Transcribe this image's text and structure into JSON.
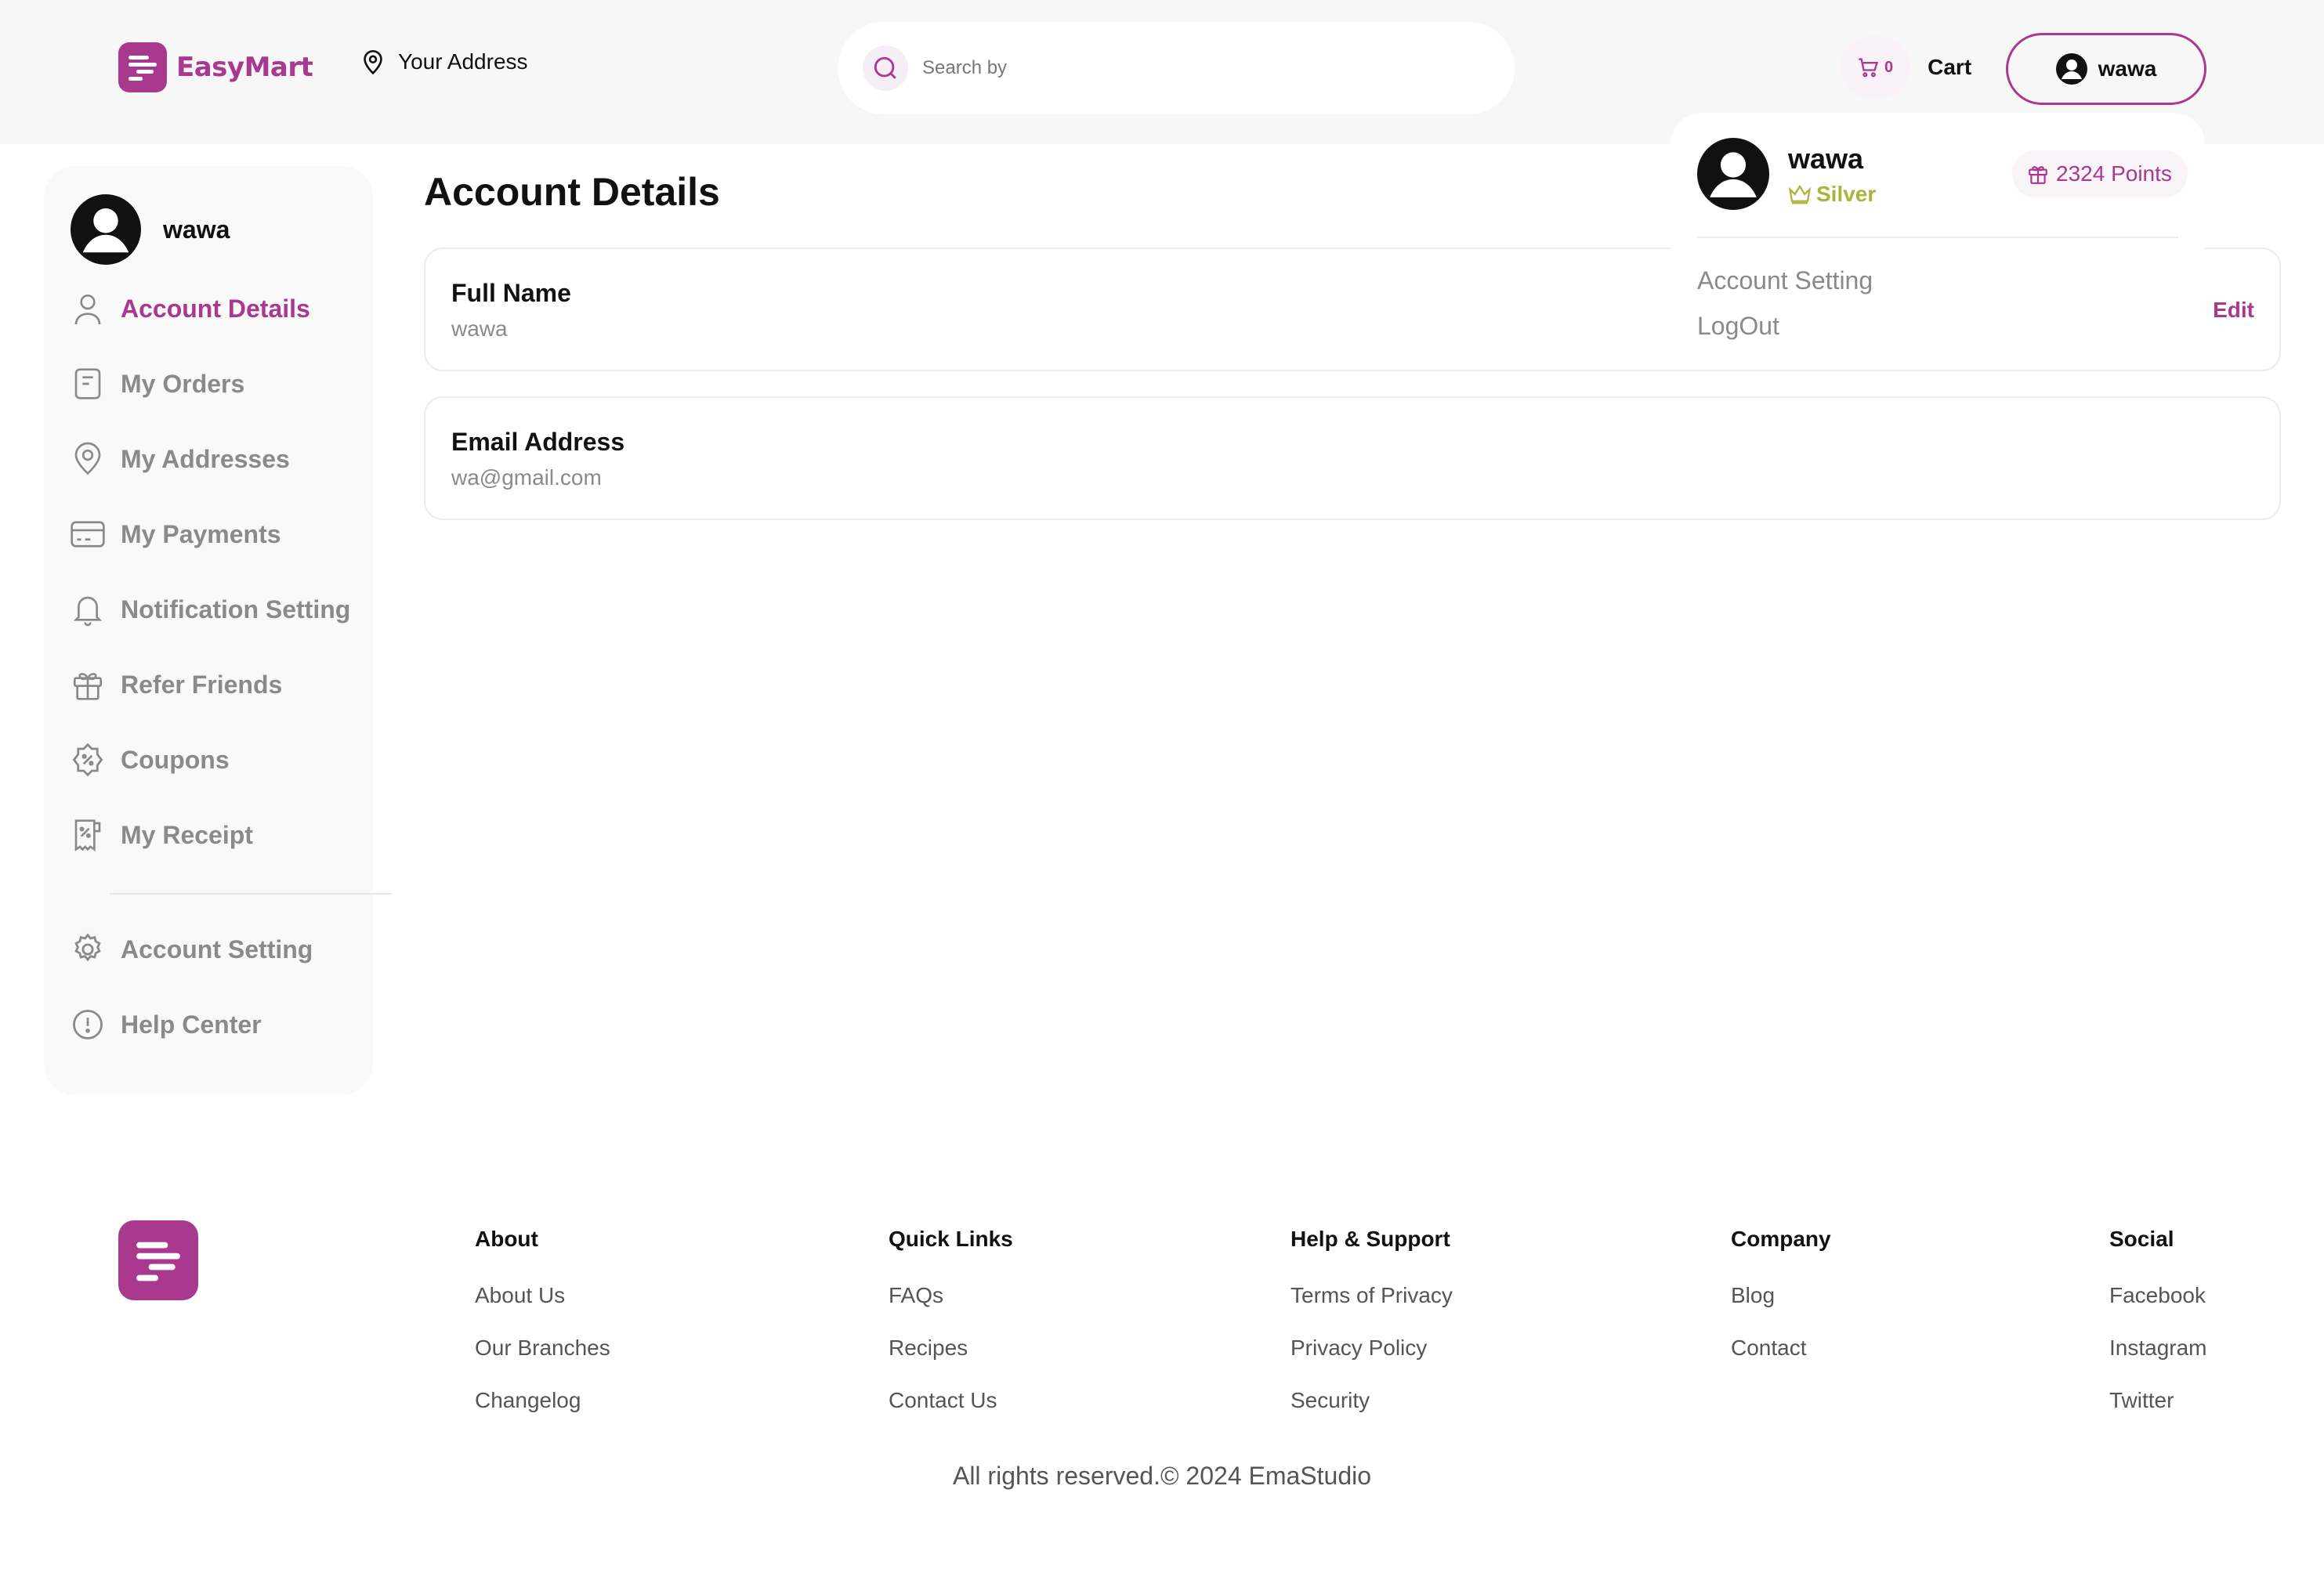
{
  "colors": {
    "brand": "#a8398f",
    "silver_tier": "#aab33a",
    "muted": "#8a8a8a"
  },
  "header": {
    "logo_text": "EasyMart",
    "address_label": "Your Address",
    "search_placeholder": "Search by",
    "cart_count": "0",
    "cart_label": "Cart",
    "user_button_label": "wawa"
  },
  "sidebar": {
    "user_name": "wawa",
    "items": [
      {
        "label": "Account Details",
        "icon": "user-icon",
        "active": true
      },
      {
        "label": "My Orders",
        "icon": "receipt-icon",
        "active": false
      },
      {
        "label": "My Addresses",
        "icon": "location-pin-icon",
        "active": false
      },
      {
        "label": "My Payments",
        "icon": "credit-card-icon",
        "active": false
      },
      {
        "label": "Notification Setting",
        "icon": "bell-icon",
        "active": false
      },
      {
        "label": "Refer Friends",
        "icon": "gift-icon",
        "active": false
      },
      {
        "label": "Coupons",
        "icon": "discount-badge-icon",
        "active": false
      },
      {
        "label": "My Receipt",
        "icon": "receipt-discount-icon",
        "active": false
      }
    ],
    "bottom_items": [
      {
        "label": "Account Setting",
        "icon": "gear-icon"
      },
      {
        "label": "Help Center",
        "icon": "info-circle-icon"
      }
    ]
  },
  "main": {
    "title": "Account Details",
    "fields": [
      {
        "label": "Full Name",
        "value": "wawa",
        "action": "Edit"
      },
      {
        "label": "Email Address",
        "value": "wa@gmail.com"
      }
    ]
  },
  "dropdown": {
    "name": "wawa",
    "tier": "Silver",
    "points": "2324 Points",
    "items": [
      "Account Setting",
      "LogOut"
    ]
  },
  "footer": {
    "columns": [
      {
        "title": "About",
        "links": [
          "About Us",
          "Our Branches",
          "Changelog"
        ]
      },
      {
        "title": "Quick Links",
        "links": [
          "FAQs",
          "Recipes",
          "Contact Us"
        ]
      },
      {
        "title": "Help & Support",
        "links": [
          "Terms of Privacy",
          "Privacy Policy",
          "Security"
        ]
      },
      {
        "title": "Company",
        "links": [
          "Blog",
          "Contact"
        ]
      },
      {
        "title": "Social",
        "links": [
          "Facebook",
          "Instagram",
          "Twitter"
        ]
      }
    ],
    "copyright": "All rights reserved.© 2024 EmaStudio"
  }
}
